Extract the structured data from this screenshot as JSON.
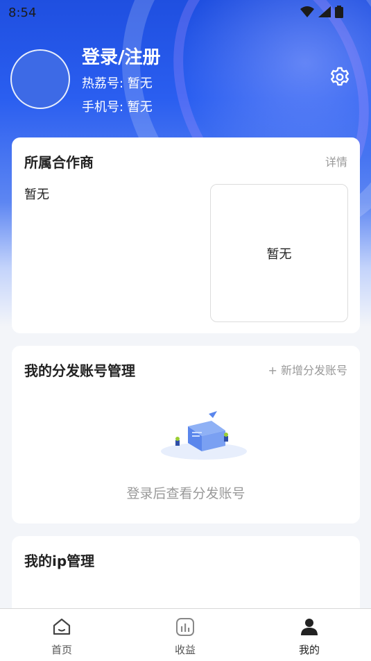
{
  "status_bar": {
    "time": "8:54"
  },
  "profile": {
    "login_label": "登录/注册",
    "hot_id_label": "热荔号: 暂无",
    "phone_label": "手机号:  暂无"
  },
  "partner_card": {
    "title": "所属合作商",
    "detail_label": "详情",
    "value": "暂无",
    "box_value": "暂无"
  },
  "distribution_card": {
    "title": "我的分发账号管理",
    "add_label": "+ 新增分发账号",
    "empty_text": "登录后查看分发账号"
  },
  "ip_card": {
    "title": "我的ip管理"
  },
  "tabbar": {
    "home_label": "首页",
    "earnings_label": "收益",
    "mine_label": "我的"
  },
  "colors": {
    "accent": "#2a5ef0",
    "muted": "#999999"
  },
  "icons": [
    "wifi-icon",
    "signal-icon",
    "battery-icon",
    "gear-icon",
    "home-icon",
    "chart-icon",
    "person-icon"
  ]
}
